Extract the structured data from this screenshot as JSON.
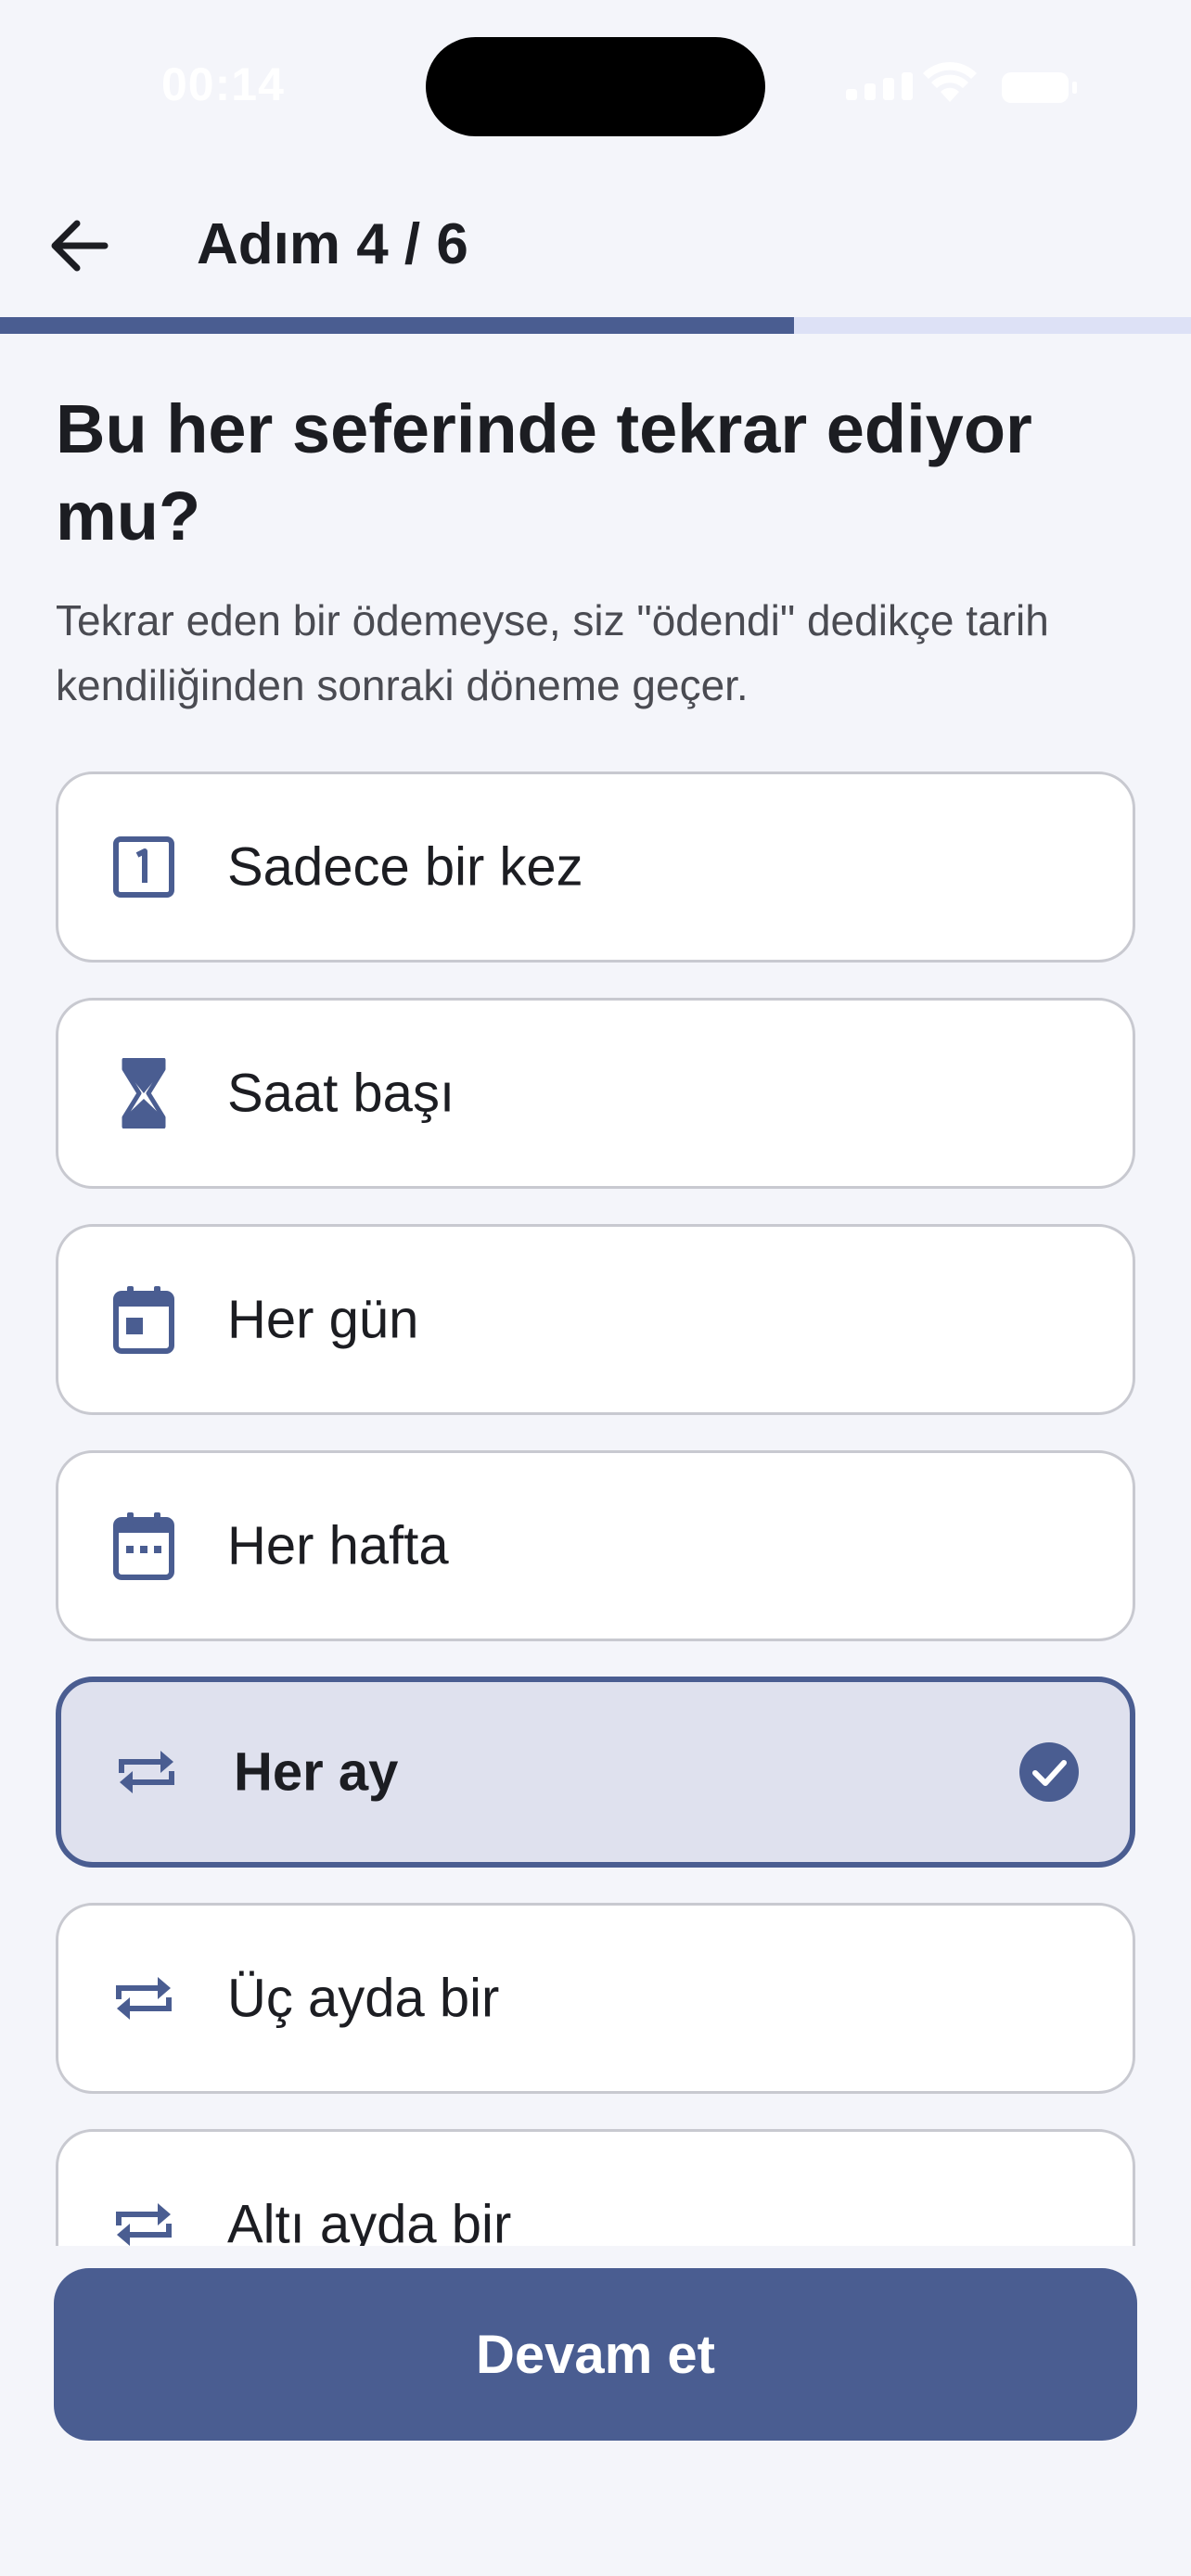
{
  "status_bar": {
    "time": "00:14"
  },
  "header": {
    "back_icon": "arrow-left-icon",
    "step_title": "Adım 4 / 6",
    "progress_fraction": 0.667
  },
  "question": {
    "title": "Bu her seferinde tekrar ediyor mu?",
    "description": "Tekrar eden bir ödemeyse, siz \"ödendi\" dedikçe tarih kendiliğinden sonraki döneme geçer."
  },
  "options": [
    {
      "label": "Sadece bir kez",
      "icon": "calendar-one-icon",
      "selected": false
    },
    {
      "label": "Saat başı",
      "icon": "hourglass-icon",
      "selected": false
    },
    {
      "label": "Her gün",
      "icon": "calendar-day-icon",
      "selected": false
    },
    {
      "label": "Her hafta",
      "icon": "calendar-week-icon",
      "selected": false
    },
    {
      "label": "Her ay",
      "icon": "repeat-icon",
      "selected": true
    },
    {
      "label": "Üç ayda bir",
      "icon": "repeat-icon",
      "selected": false
    },
    {
      "label": "Altı ayda bir",
      "icon": "repeat-icon",
      "selected": false
    }
  ],
  "continue_button": {
    "label": "Devam et"
  },
  "colors": {
    "accent": "#4a5d91",
    "selected_bg": "#dfe1ee",
    "progress_track": "#dde1f6",
    "background": "#f4f5fa"
  }
}
